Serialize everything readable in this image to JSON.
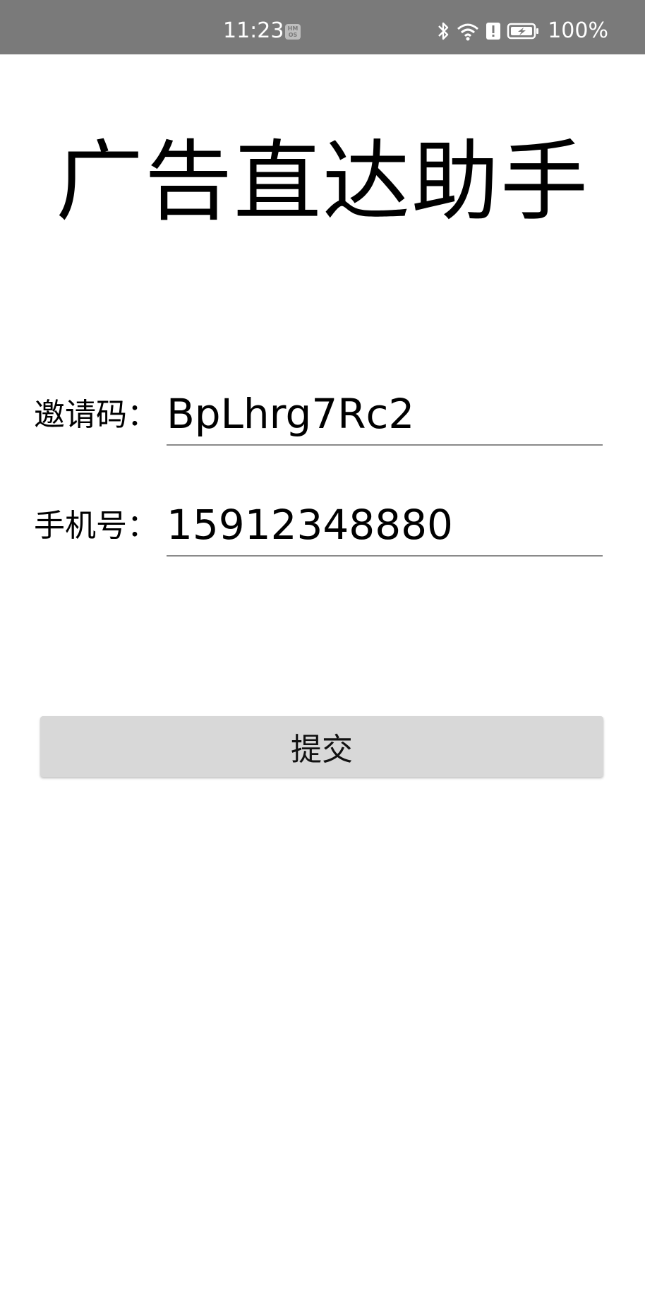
{
  "status_bar": {
    "time": "11:23",
    "os_badge": "HM OS",
    "battery_percent": "100%",
    "icons": [
      "bluetooth-icon",
      "wifi-icon",
      "alert-icon",
      "battery-charging-icon"
    ],
    "background_color": "#7a7a7a"
  },
  "app": {
    "title": "广告直达助手"
  },
  "form": {
    "invite_code": {
      "label": "邀请码：",
      "value": "BpLhrg7Rc2"
    },
    "phone": {
      "label": "手机号：",
      "value": "15912348880"
    },
    "submit_label": "提交"
  }
}
